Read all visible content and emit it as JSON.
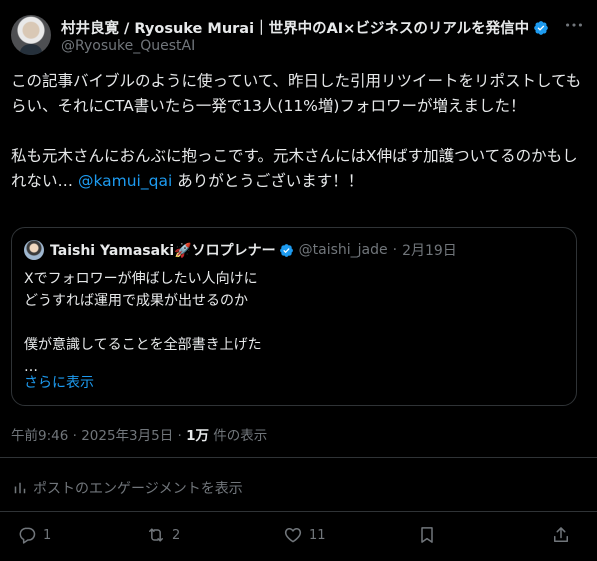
{
  "author": {
    "name": "村井良寛 / Ryosuke Murai｜世界中のAI×ビジネスのリアルを発信中",
    "handle": "@Ryosuke_QuestAI"
  },
  "post": {
    "paragraph1": "この記事バイブルのように使っていて、昨日した引用リツイートをリポストしてもらい、それにCTA書いたら一発で13人(11%増)フォロワーが増えました！",
    "paragraph2_before": "私も元木さんにおんぶに抱っこです。元木さんにはX伸ばす加護ついてるのかもしれない… ",
    "mention": "@kamui_qai",
    "paragraph2_after": " ありがとうございます！！"
  },
  "quote": {
    "name": "Taishi Yamasaki🚀ソロプレナー",
    "handle": "@taishi_jade",
    "date": "2月19日",
    "line1": "Xでフォロワーが伸ばしたい人向けに",
    "line2": "どうすれば運用で成果が出せるのか",
    "line3": "僕が意識してることを全部書き上げた",
    "line4": "…",
    "show_more": "さらに表示"
  },
  "meta": {
    "time": "午前9:46 · 2025年3月5日 · ",
    "views_count": "1万",
    "views_label": " 件の表示"
  },
  "engagement_label": "ポストのエンゲージメントを表示",
  "actions": {
    "replies": "1",
    "reposts": "2",
    "likes": "11"
  },
  "colors": {
    "background": "#000000",
    "text": "#e7e9ea",
    "secondary": "#71767b",
    "accent": "#1d9bf0",
    "border": "#2f3336"
  }
}
